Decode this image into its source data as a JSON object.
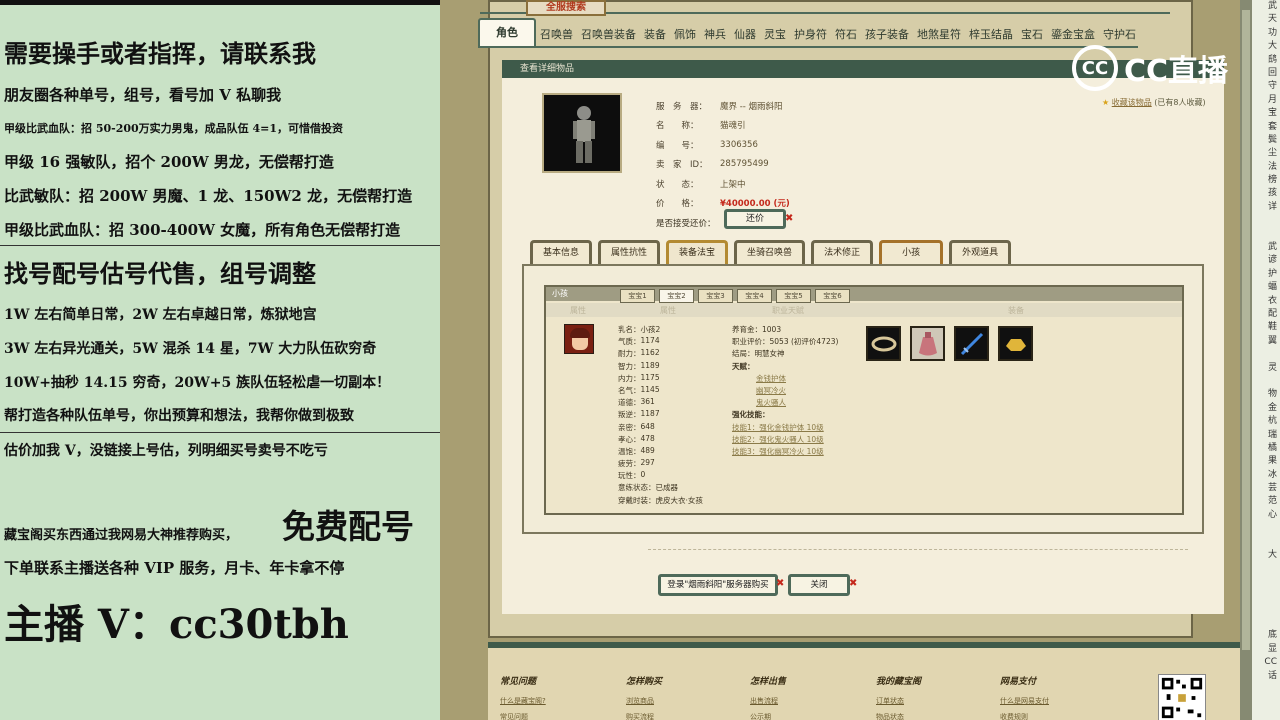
{
  "left_panel": {
    "lines": [
      "需要操手或者指挥，请联系我",
      "朋友圈各种单号，组号，看号加 V 私聊我",
      "甲级比武血队：招 50-200万实力男鬼，成品队伍 4=1，可惜借投资",
      "甲级 16 强敏队，招个 200W 男龙，无偿帮打造",
      "比武敏队：招 200W 男魔、1 龙、150W2 龙，无偿帮打造",
      "甲级比武血队：招 300-400W 女魔，所有角色无偿帮打造",
      "找号配号估号代售，组号调整",
      "1W 左右简单日常，2W 左右卓越日常，炼狱地宫",
      "3W 左右异光通关，5W 混杀 14 星，7W 大力队伍砍穷奇",
      "10W+抽秒 14.15 穷奇，20W+5 族队伍轻松虐一切副本！",
      "帮打造各种队伍单号，你出预算和想法，我帮你做到极致",
      "估价加我 V，没链接上号估，列明细买号卖号不吃亏",
      "藏宝阁买东西通过我网易大神推荐购买，",
      "免费配号",
      "下单联系主播送各种 VIP 服务，月卡、年卡拿不停",
      "主播 V：cc30tbh"
    ]
  },
  "banner": "全服搜索",
  "categories": [
    "角色",
    "召唤兽",
    "召唤兽装备",
    "装备",
    "佩饰",
    "神兵",
    "仙器",
    "灵宝",
    "护身符",
    "符石",
    "孩子装备",
    "地煞星符",
    "梓玉结晶",
    "宝石",
    "鎏金宝盒",
    "守护石"
  ],
  "header": "查看详细物品",
  "watermark": "CC直播",
  "info": [
    {
      "key": "服　务　器：",
      "value": "魔界 -- 烟雨斜阳"
    },
    {
      "key": "名　　称：",
      "value": "猫魂引"
    },
    {
      "key": "编　　号：",
      "value": "3306356"
    },
    {
      "key": "卖　家　ID：",
      "value": "285795499"
    },
    {
      "key": "状　　态：",
      "value": "上架中"
    },
    {
      "key": "价　　格：",
      "value": "¥40000.00 (元)"
    }
  ],
  "bargain": {
    "label": "是否接受还价：",
    "button": "还价"
  },
  "collect": {
    "link": "收藏该物品",
    "note": "(已有8人收藏)"
  },
  "section_tabs": [
    "基本信息",
    "属性抗性",
    "装备法宝",
    "坐骑召唤兽",
    "法术修正",
    "小孩",
    "外观道具"
  ],
  "child_panel": {
    "title": "小孩",
    "tabs": [
      "宝宝1",
      "宝宝2",
      "宝宝3",
      "宝宝4",
      "宝宝5",
      "宝宝6"
    ],
    "col_heads": [
      "属性",
      "属性",
      "职业天赋",
      "装备"
    ],
    "stats": [
      [
        "乳名",
        "小孩2"
      ],
      [
        "气质",
        "1174"
      ],
      [
        "耐力",
        "1162"
      ],
      [
        "智力",
        "1189"
      ],
      [
        "内力",
        "1175"
      ],
      [
        "名气",
        "1145"
      ],
      [
        "道德",
        "361"
      ],
      [
        "叛逆",
        "1187"
      ],
      [
        "亲密",
        "648"
      ],
      [
        "孝心",
        "478"
      ],
      [
        "温饱",
        "489"
      ],
      [
        "疲劳",
        "297"
      ],
      [
        "玩性",
        "0"
      ],
      [
        "意练状态",
        "已成器"
      ],
      [
        "穿戴时装",
        "虎皮大衣·女孩"
      ]
    ],
    "career": {
      "lines": [
        "养育金：1003",
        "职业评价：5053 (初评价4723)",
        "结局：明慧女神",
        "天赋：",
        "金钱护体",
        "幽冥冷火",
        "鬼火骚人",
        "强化技能：",
        "技能1：强化金钱护体 10级",
        "技能2：强化鬼火骚人 10级",
        "技能3：强化幽冥冷火 10级"
      ]
    },
    "items": [
      "bracelet-icon",
      "pouch-icon",
      "sword-icon",
      "gold-ingot-icon"
    ]
  },
  "bottom_buttons": {
    "buy": "登录\"烟雨斜阳\"服务器购买",
    "close": "关闭"
  },
  "footer": [
    {
      "title": "常见问题",
      "links": [
        "什么是藏宝阁?",
        "常见问题"
      ]
    },
    {
      "title": "怎样购买",
      "links": [
        "浏览商品",
        "购买流程"
      ]
    },
    {
      "title": "怎样出售",
      "links": [
        "出售流程",
        "公示期"
      ]
    },
    {
      "title": "我的藏宝阁",
      "links": [
        "订单状态",
        "物品状态"
      ]
    },
    {
      "title": "网易支付",
      "links": [
        "什么是网易支付",
        "收费规则"
      ]
    }
  ],
  "right_strip": [
    "武",
    "天",
    "功",
    "大",
    "鸱",
    "回",
    "守",
    "月",
    "宝",
    "套",
    "鬓",
    "尘",
    "法",
    "榜",
    "孩",
    "详",
    "",
    "",
    "武",
    "谚",
    "护",
    "蝠",
    "衣",
    "配",
    "鞋",
    "翼",
    "",
    "灵",
    "",
    "物",
    "金",
    "杭",
    "瑞",
    "橘",
    "果",
    "冰",
    "芸",
    "范",
    "心",
    "",
    "",
    "大",
    "",
    "",
    "",
    "",
    "",
    "底",
    "显",
    "CC",
    "话"
  ]
}
